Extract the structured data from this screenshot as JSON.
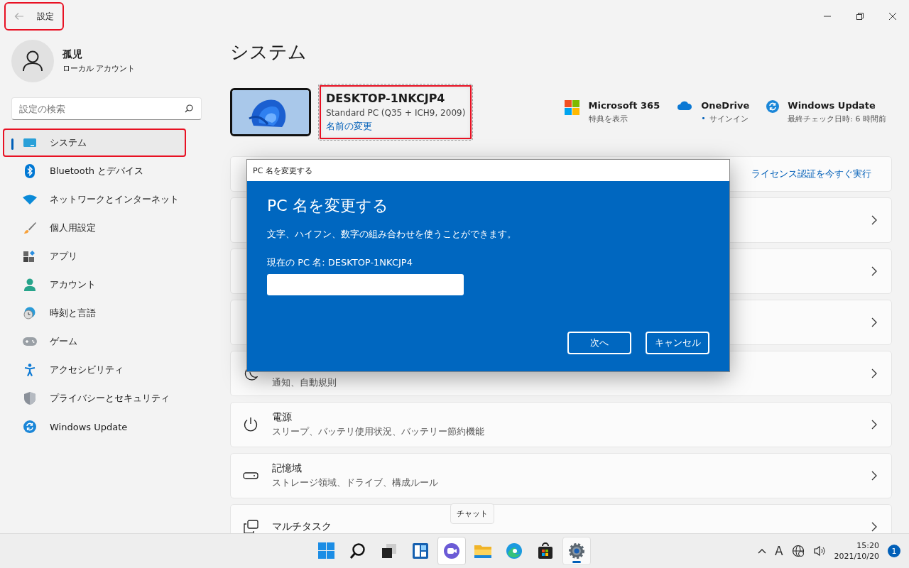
{
  "window": {
    "title": "設定",
    "highlighted": true
  },
  "user": {
    "name": "孤児",
    "account_type": "ローカル アカウント"
  },
  "search": {
    "placeholder": "設定の検索"
  },
  "nav": [
    {
      "label": "システム",
      "selected": true,
      "highlighted": true
    },
    {
      "label": "Bluetooth とデバイス",
      "selected": false,
      "highlighted": false
    },
    {
      "label": "ネットワークとインターネット",
      "selected": false,
      "highlighted": false
    },
    {
      "label": "個人用設定",
      "selected": false,
      "highlighted": false
    },
    {
      "label": "アプリ",
      "selected": false,
      "highlighted": false
    },
    {
      "label": "アカウント",
      "selected": false,
      "highlighted": false
    },
    {
      "label": "時刻と言語",
      "selected": false,
      "highlighted": false
    },
    {
      "label": "ゲーム",
      "selected": false,
      "highlighted": false
    },
    {
      "label": "アクセシビリティ",
      "selected": false,
      "highlighted": false
    },
    {
      "label": "プライバシーとセキュリティ",
      "selected": false,
      "highlighted": false
    },
    {
      "label": "Windows Update",
      "selected": false,
      "highlighted": false
    }
  ],
  "page": {
    "title": "システム",
    "device": {
      "name": "DESKTOP-1NKCJP4",
      "model": "Standard PC (Q35 + ICH9, 2009)",
      "rename_link": "名前の変更",
      "highlighted": true
    },
    "services": [
      {
        "title": "Microsoft 365",
        "subtitle": "特典を表示"
      },
      {
        "title": "OneDrive",
        "status_mark": "•",
        "subtitle": "サインイン"
      },
      {
        "title": "Windows Update",
        "subtitle": "最終チェック日時: 6 時間前"
      }
    ],
    "license_link": "ライセンス認証を今すぐ実行",
    "settings": [
      {
        "kind": "covered"
      },
      {
        "kind": "covered"
      },
      {
        "kind": "covered"
      },
      {
        "kind": "item",
        "subtitle": "通知、自動規則"
      },
      {
        "kind": "item",
        "title": "電源",
        "subtitle": "スリープ、バッテリ使用状況、バッテリー節約機能"
      },
      {
        "kind": "item",
        "title": "記憶域",
        "subtitle": "ストレージ領域、ドライブ、構成ルール"
      },
      {
        "kind": "item",
        "title": "マルチタスク"
      }
    ]
  },
  "dialog": {
    "caption": "PC 名を変更する",
    "heading": "PC 名を変更する",
    "description": "文字、ハイフン、数字の組み合わせを使うことができます。",
    "current_name": "現在の PC 名: DESKTOP-1NKCJP4",
    "buttons": [
      "次へ",
      "キャンセル"
    ]
  },
  "taskbar": {
    "apps": [
      {
        "active": false,
        "hovered": false
      },
      {
        "active": false,
        "hovered": false
      },
      {
        "active": false,
        "hovered": false
      },
      {
        "active": false,
        "hovered": false
      },
      {
        "active": false,
        "hovered": true
      },
      {
        "active": false,
        "hovered": false
      },
      {
        "active": false,
        "hovered": false
      },
      {
        "active": false,
        "hovered": false
      },
      {
        "active": true,
        "hovered": false
      }
    ],
    "tooltip": "チャット",
    "input_indicator": "A",
    "time": "15:20",
    "date": "2021/10/20",
    "notification_count": "1"
  }
}
